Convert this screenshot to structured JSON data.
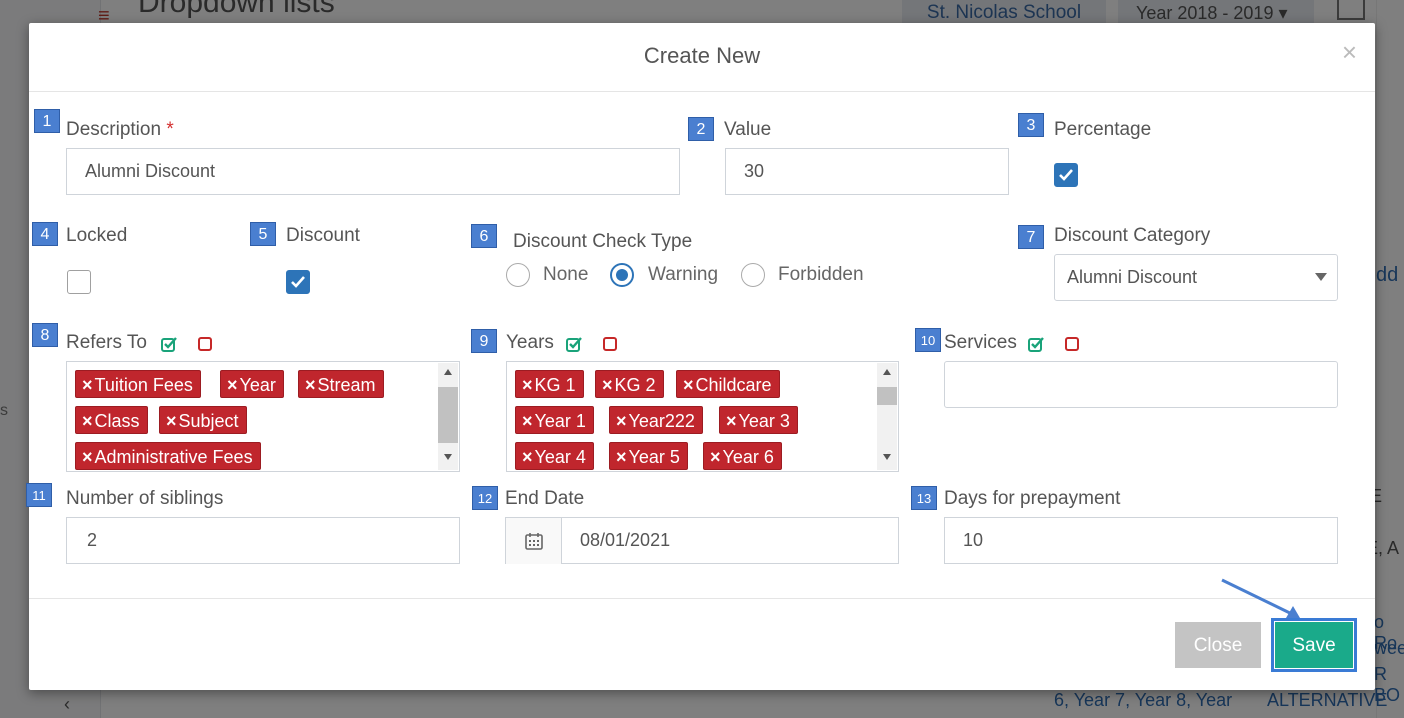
{
  "background": {
    "page_title": "Dropdown lists",
    "school": "St. Nicolas School",
    "year_selector": "Year 2018 - 2019",
    "right_add_text": "dd",
    "right_text_1": "E",
    "right_text_2": "E, A",
    "link_1": "o Ro",
    "link_2": "wee",
    "link_3": "R BO",
    "link_4": "6, Year 7, Year 8, Year",
    "link_5": "ALTERNATIVE",
    "left_text": "s",
    "chevron": "‹"
  },
  "modal": {
    "title": "Create New",
    "close_glyph": "×"
  },
  "fields": {
    "description": {
      "num": "1",
      "label": "Description",
      "required": "*",
      "value": "Alumni Discount"
    },
    "value": {
      "num": "2",
      "label": "Value",
      "value": "30"
    },
    "percentage": {
      "num": "3",
      "label": "Percentage",
      "checked": true
    },
    "locked": {
      "num": "4",
      "label": "Locked",
      "checked": false
    },
    "discount": {
      "num": "5",
      "label": "Discount",
      "checked": true
    },
    "discount_check_type": {
      "num": "6",
      "label": "Discount Check Type",
      "options": [
        "None",
        "Warning",
        "Forbidden"
      ],
      "selected": "Warning"
    },
    "discount_category": {
      "num": "7",
      "label": "Discount Category",
      "value": "Alumni Discount"
    },
    "refers_to": {
      "num": "8",
      "label": "Refers To",
      "tags": [
        "Tuition Fees",
        "Year",
        "Stream",
        "Class",
        "Subject",
        "Administrative Fees"
      ]
    },
    "years": {
      "num": "9",
      "label": "Years",
      "tags": [
        "KG 1",
        "KG 2",
        "Childcare",
        "Year 1",
        "Year222",
        "Year 3",
        "Year 4",
        "Year 5",
        "Year 6"
      ]
    },
    "services": {
      "num": "10",
      "label": "Services",
      "tags": []
    },
    "number_of_siblings": {
      "num": "11",
      "label": "Number of siblings",
      "value": "2"
    },
    "end_date": {
      "num": "12",
      "label": "End Date",
      "value": "08/01/2021"
    },
    "days_for_prepayment": {
      "num": "13",
      "label": "Days for prepayment",
      "value": "10"
    }
  },
  "tag_remove_glyph": "×",
  "footer": {
    "close_label": "Close",
    "save_label": "Save"
  },
  "colors": {
    "accent": "#2d74b8",
    "tag": "#c0262d",
    "save": "#1aaa8a",
    "close": "#c4c4c4",
    "step_badge": "#4a7fd0"
  }
}
